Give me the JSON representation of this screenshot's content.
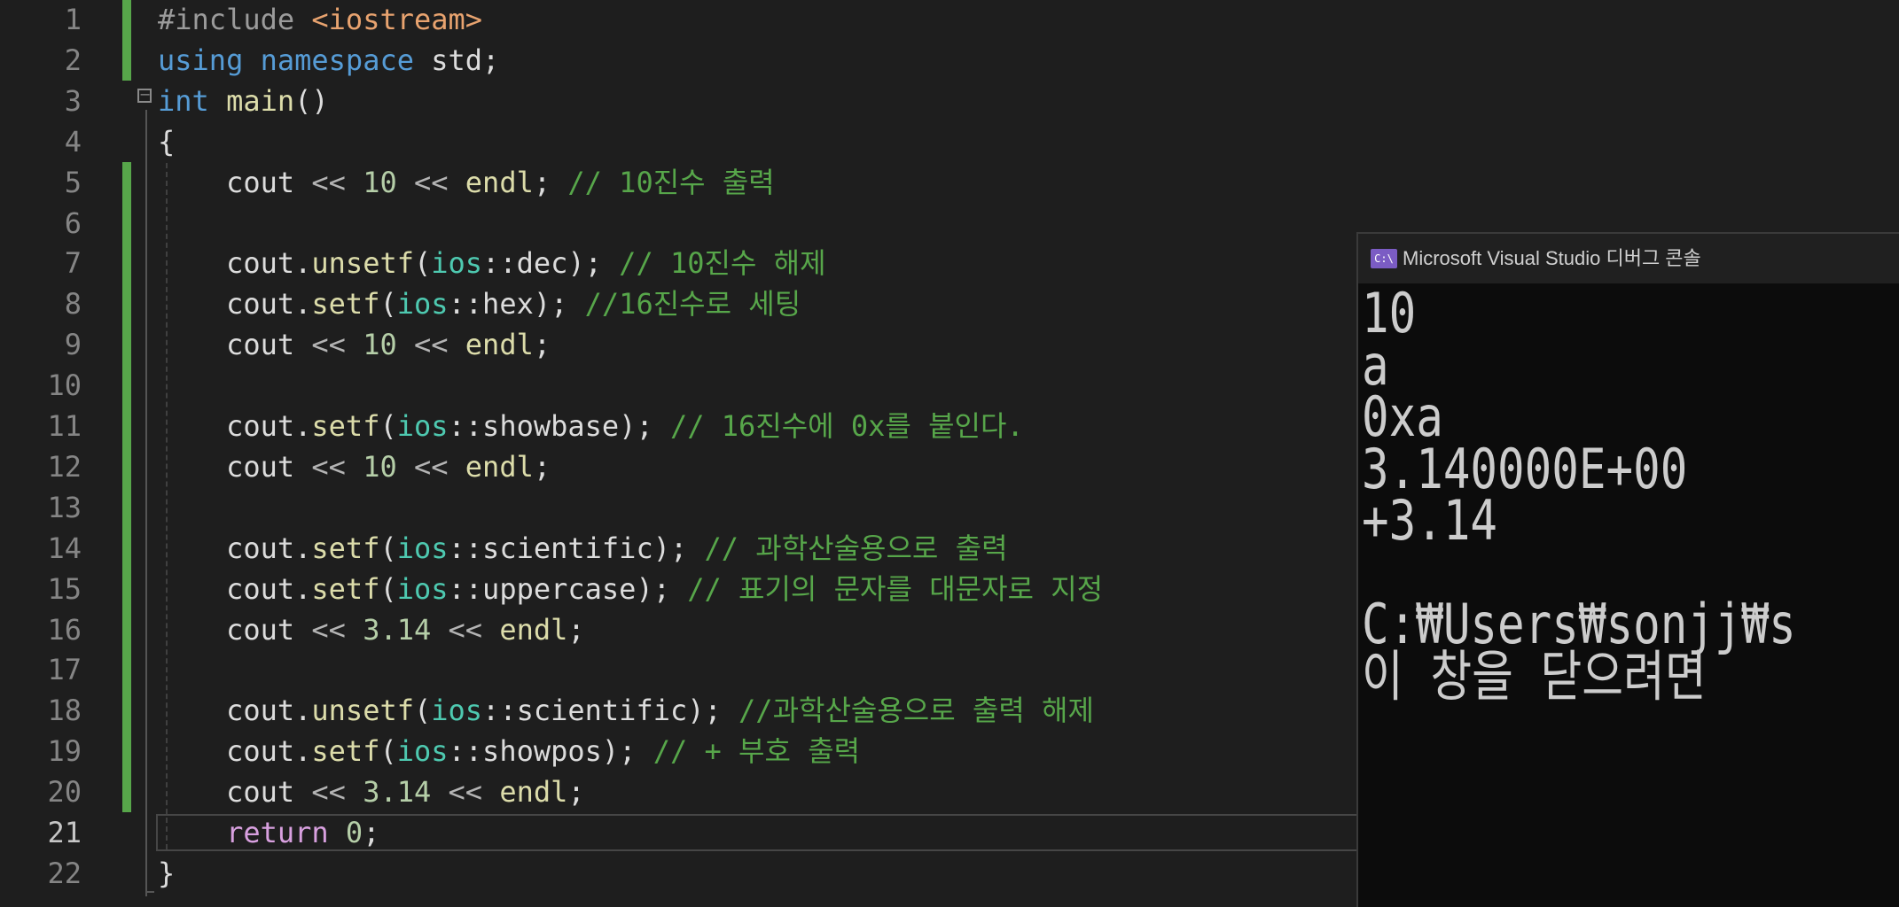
{
  "editor": {
    "active_line": 21,
    "lines": [
      {
        "n": "1",
        "mod": true,
        "tokens": [
          [
            "pre",
            "#include "
          ],
          [
            "str",
            "<iostream>"
          ]
        ]
      },
      {
        "n": "2",
        "mod": true,
        "tokens": [
          [
            "kw",
            "using"
          ],
          [
            "id",
            " "
          ],
          [
            "kw",
            "namespace"
          ],
          [
            "id",
            " std;"
          ]
        ]
      },
      {
        "n": "3",
        "mod": false,
        "tokens": [
          [
            "kw",
            "int"
          ],
          [
            "id",
            " "
          ],
          [
            "fn",
            "main"
          ],
          [
            "id",
            "()"
          ]
        ]
      },
      {
        "n": "4",
        "mod": false,
        "tokens": [
          [
            "id",
            "{"
          ]
        ]
      },
      {
        "n": "5",
        "mod": true,
        "tokens": [
          [
            "id",
            "    cout "
          ],
          [
            "op",
            "<<"
          ],
          [
            "id",
            " "
          ],
          [
            "num",
            "10"
          ],
          [
            "id",
            " "
          ],
          [
            "op",
            "<<"
          ],
          [
            "id",
            " "
          ],
          [
            "fn",
            "endl"
          ],
          [
            "id",
            "; "
          ],
          [
            "cm",
            "// 10진수 출력"
          ]
        ]
      },
      {
        "n": "6",
        "mod": true,
        "tokens": []
      },
      {
        "n": "7",
        "mod": true,
        "tokens": [
          [
            "id",
            "    cout."
          ],
          [
            "fn",
            "unsetf"
          ],
          [
            "id",
            "("
          ],
          [
            "ty",
            "ios"
          ],
          [
            "id",
            "::dec); "
          ],
          [
            "cm",
            "// 10진수 해제"
          ]
        ]
      },
      {
        "n": "8",
        "mod": true,
        "tokens": [
          [
            "id",
            "    cout."
          ],
          [
            "fn",
            "setf"
          ],
          [
            "id",
            "("
          ],
          [
            "ty",
            "ios"
          ],
          [
            "id",
            "::hex); "
          ],
          [
            "cm",
            "//16진수로 세팅"
          ]
        ]
      },
      {
        "n": "9",
        "mod": true,
        "tokens": [
          [
            "id",
            "    cout "
          ],
          [
            "op",
            "<<"
          ],
          [
            "id",
            " "
          ],
          [
            "num",
            "10"
          ],
          [
            "id",
            " "
          ],
          [
            "op",
            "<<"
          ],
          [
            "id",
            " "
          ],
          [
            "fn",
            "endl"
          ],
          [
            "id",
            ";"
          ]
        ]
      },
      {
        "n": "10",
        "mod": true,
        "tokens": []
      },
      {
        "n": "11",
        "mod": true,
        "tokens": [
          [
            "id",
            "    cout."
          ],
          [
            "fn",
            "setf"
          ],
          [
            "id",
            "("
          ],
          [
            "ty",
            "ios"
          ],
          [
            "id",
            "::showbase); "
          ],
          [
            "cm",
            "// 16진수에 0x를 붙인다."
          ]
        ]
      },
      {
        "n": "12",
        "mod": true,
        "tokens": [
          [
            "id",
            "    cout "
          ],
          [
            "op",
            "<<"
          ],
          [
            "id",
            " "
          ],
          [
            "num",
            "10"
          ],
          [
            "id",
            " "
          ],
          [
            "op",
            "<<"
          ],
          [
            "id",
            " "
          ],
          [
            "fn",
            "endl"
          ],
          [
            "id",
            ";"
          ]
        ]
      },
      {
        "n": "13",
        "mod": true,
        "tokens": []
      },
      {
        "n": "14",
        "mod": true,
        "tokens": [
          [
            "id",
            "    cout."
          ],
          [
            "fn",
            "setf"
          ],
          [
            "id",
            "("
          ],
          [
            "ty",
            "ios"
          ],
          [
            "id",
            "::scientific); "
          ],
          [
            "cm",
            "// 과학산술용으로 출력"
          ]
        ]
      },
      {
        "n": "15",
        "mod": true,
        "tokens": [
          [
            "id",
            "    cout."
          ],
          [
            "fn",
            "setf"
          ],
          [
            "id",
            "("
          ],
          [
            "ty",
            "ios"
          ],
          [
            "id",
            "::uppercase); "
          ],
          [
            "cm",
            "// 표기의 문자를 대문자로 지정"
          ]
        ]
      },
      {
        "n": "16",
        "mod": true,
        "tokens": [
          [
            "id",
            "    cout "
          ],
          [
            "op",
            "<<"
          ],
          [
            "id",
            " "
          ],
          [
            "num",
            "3.14"
          ],
          [
            "id",
            " "
          ],
          [
            "op",
            "<<"
          ],
          [
            "id",
            " "
          ],
          [
            "fn",
            "endl"
          ],
          [
            "id",
            ";"
          ]
        ]
      },
      {
        "n": "17",
        "mod": true,
        "tokens": []
      },
      {
        "n": "18",
        "mod": true,
        "tokens": [
          [
            "id",
            "    cout."
          ],
          [
            "fn",
            "unsetf"
          ],
          [
            "id",
            "("
          ],
          [
            "ty",
            "ios"
          ],
          [
            "id",
            "::scientific); "
          ],
          [
            "cm",
            "//과학산술용으로 출력 해제"
          ]
        ]
      },
      {
        "n": "19",
        "mod": true,
        "tokens": [
          [
            "id",
            "    cout."
          ],
          [
            "fn",
            "setf"
          ],
          [
            "id",
            "("
          ],
          [
            "ty",
            "ios"
          ],
          [
            "id",
            "::showpos); "
          ],
          [
            "cm",
            "// + 부호 출력"
          ]
        ]
      },
      {
        "n": "20",
        "mod": true,
        "tokens": [
          [
            "id",
            "    cout "
          ],
          [
            "op",
            "<<"
          ],
          [
            "id",
            " "
          ],
          [
            "num",
            "3.14"
          ],
          [
            "id",
            " "
          ],
          [
            "op",
            "<<"
          ],
          [
            "id",
            " "
          ],
          [
            "fn",
            "endl"
          ],
          [
            "id",
            ";"
          ]
        ]
      },
      {
        "n": "21",
        "mod": false,
        "tokens": [
          [
            "id",
            "    "
          ],
          [
            "ctl",
            "return"
          ],
          [
            "id",
            " "
          ],
          [
            "num",
            "0"
          ],
          [
            "id",
            ";"
          ]
        ]
      },
      {
        "n": "22",
        "mod": false,
        "tokens": [
          [
            "id",
            "}"
          ]
        ]
      }
    ]
  },
  "console": {
    "icon_label": "C:\\",
    "title": "Microsoft Visual Studio 디버그 콘솔",
    "lines": [
      "10",
      "a",
      "0xa",
      "3.140000E+00",
      "+3.14",
      "",
      "C:₩Users₩sonjj₩s",
      "이 창을 닫으려면"
    ]
  },
  "colors": {
    "background": "#1e1e1e",
    "modified_bar": "#57a64a",
    "console_background": "#0c0c0c"
  }
}
